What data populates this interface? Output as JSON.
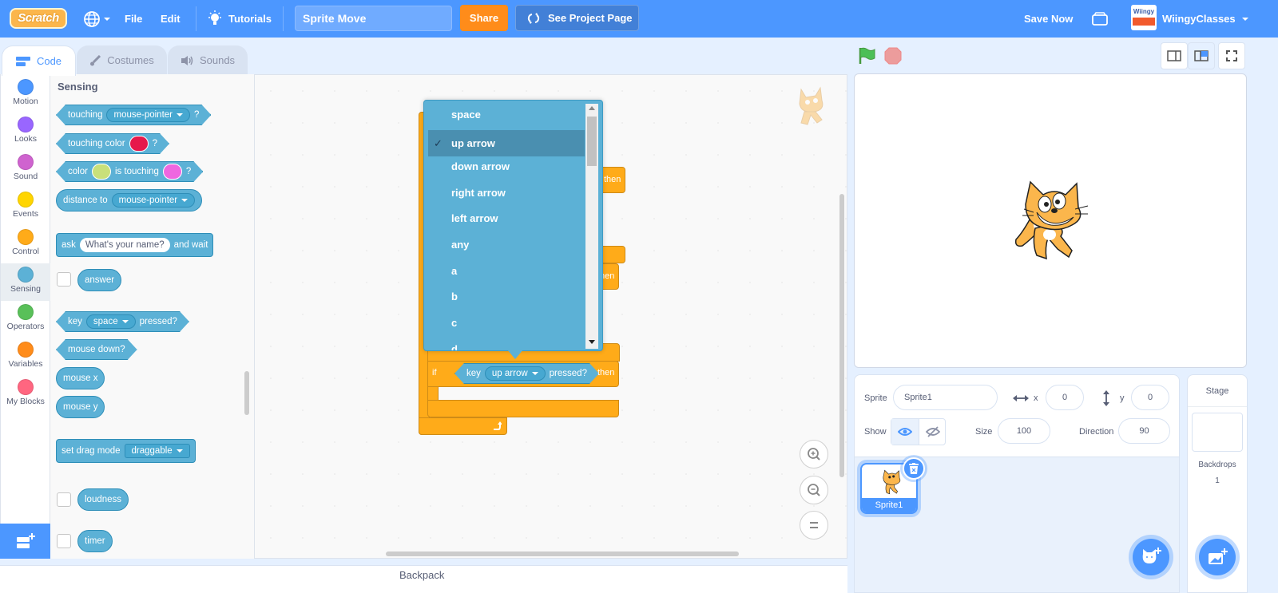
{
  "menubar": {
    "logo": "Scratch",
    "language_icon": "globe-icon",
    "file": "File",
    "edit": "Edit",
    "tutorials": "Tutorials",
    "project_title": "Sprite Move",
    "share": "Share",
    "see_project_page": "See Project Page",
    "save_now": "Save Now",
    "username": "WiingyClasses",
    "avatar_text": "Wiingy"
  },
  "tabs": [
    {
      "label": "Code",
      "active": true
    },
    {
      "label": "Costumes",
      "active": false
    },
    {
      "label": "Sounds",
      "active": false
    }
  ],
  "categories": [
    {
      "label": "Motion",
      "color": "#4c97ff"
    },
    {
      "label": "Looks",
      "color": "#9966ff"
    },
    {
      "label": "Sound",
      "color": "#cf63cf"
    },
    {
      "label": "Events",
      "color": "#ffd500"
    },
    {
      "label": "Control",
      "color": "#ffab19"
    },
    {
      "label": "Sensing",
      "color": "#5cb1d6",
      "selected": true
    },
    {
      "label": "Operators",
      "color": "#59c059"
    },
    {
      "label": "Variables",
      "color": "#ff8c1a"
    },
    {
      "label": "My Blocks",
      "color": "#ff6680"
    }
  ],
  "palette": {
    "heading": "Sensing",
    "touching": {
      "label": "touching",
      "menu": "mouse-pointer",
      "suffix": "?"
    },
    "touching_color": {
      "label": "touching color",
      "color": "#e6194b",
      "suffix": "?"
    },
    "color_touching": {
      "label1": "color",
      "color1": "#c9e07a",
      "label2": "is touching",
      "color2": "#ef67e0",
      "suffix": "?"
    },
    "distance_to": {
      "label": "distance to",
      "menu": "mouse-pointer"
    },
    "ask": {
      "label": "ask",
      "input": "What's your name?",
      "suffix": "and wait"
    },
    "answer": "answer",
    "key_pressed": {
      "label": "key",
      "menu": "space",
      "suffix": "pressed?"
    },
    "mouse_down": "mouse down?",
    "mouse_x": "mouse x",
    "mouse_y": "mouse y",
    "set_drag_mode": {
      "label": "set drag mode",
      "menu": "draggable"
    },
    "loudness": "loudness",
    "timer": "timer"
  },
  "workspace": {
    "then_labels": [
      "then",
      "then",
      "then"
    ],
    "if_label": "if",
    "key_block": {
      "label": "key",
      "menu": "up arrow",
      "suffix": "pressed?"
    }
  },
  "dropdown": {
    "options": [
      "space",
      "up arrow",
      "down arrow",
      "right arrow",
      "left arrow",
      "any",
      "a",
      "b",
      "c",
      "d"
    ],
    "selected": "up arrow",
    "check": "✓"
  },
  "sprite_info": {
    "sprite_label": "Sprite",
    "sprite_name": "Sprite1",
    "x_label": "x",
    "x_value": "0",
    "y_label": "y",
    "y_value": "0",
    "show_label": "Show",
    "size_label": "Size",
    "size_value": "100",
    "direction_label": "Direction",
    "direction_value": "90"
  },
  "sprites": [
    {
      "name": "Sprite1",
      "selected": true
    }
  ],
  "stage_pane": {
    "title": "Stage",
    "backdrops_label": "Backdrops",
    "backdrops_count": "1"
  },
  "backpack": "Backpack",
  "colors": {
    "brand": "#4c97ff",
    "sensing": "#5cb1d6",
    "control": "#ffab19",
    "share": "#ff8c1a"
  }
}
